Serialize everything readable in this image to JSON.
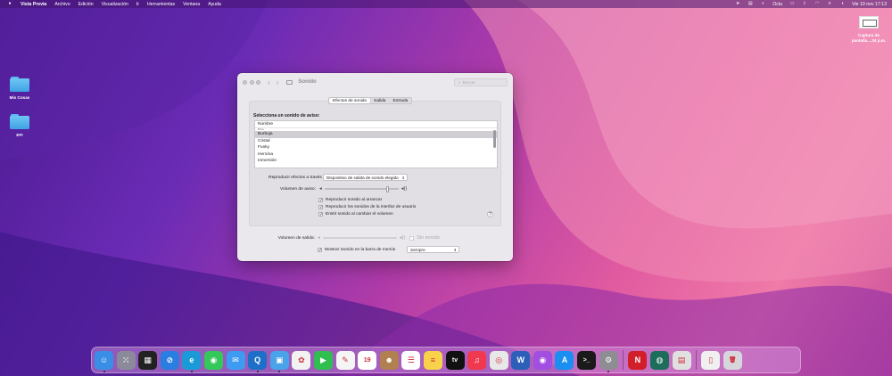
{
  "menubar": {
    "apple": "",
    "app_name": "Vista Previa",
    "menus": [
      "Archivo",
      "Edición",
      "Visualización",
      "Ir",
      "Herramientas",
      "Ventana",
      "Ayuda"
    ],
    "status_text": "Octu",
    "clock": "Vie 19 nov  17:13"
  },
  "desktop": {
    "screenshot_label": "Captura de pantalla....34 p.m.",
    "folder1": "Mis Cosas",
    "folder2": "EFI"
  },
  "window": {
    "title": "Sonido",
    "search_placeholder": "Buscar",
    "tabs": [
      "Efectos de sonido",
      "Salida",
      "Entrada"
    ],
    "heading": "Selecciona un sonido de aviso:",
    "list_header": "Nombre",
    "list_cut_row": "Brisa",
    "list_items": [
      "Burbuja",
      "Cristal",
      "Funky",
      "Heroína",
      "Inmersión"
    ],
    "selected_item": "Burbuja",
    "play_effects_label": "Reproducir efectos a través de:",
    "play_effects_value": "Dispositivo de salida de sonido elegido",
    "alert_volume_label": "Volumen de aviso:",
    "alert_volume_level": 0.85,
    "checks": [
      {
        "label": "Reproducir sonido al arrancar",
        "checked": true
      },
      {
        "label": "Reproducir los sonidos de la interfaz de usuario",
        "checked": true
      },
      {
        "label": "Emitir sonido al cambiar el volumen",
        "checked": true
      }
    ],
    "help": "?",
    "output_volume_label": "Volumen de salida:",
    "mute_label": "Sin sonido",
    "show_menu_label": "Mostrar Sonido en la barra de menús",
    "show_menu_value": "siempre"
  },
  "dock": {
    "apps": [
      {
        "icon": "finder-icon",
        "color": "#3a8ee6",
        "glyph": "☺",
        "running": true
      },
      {
        "icon": "launchpad-icon",
        "color": "#8a8a9a",
        "glyph": "⁙",
        "running": false
      },
      {
        "icon": "mission-control-icon",
        "color": "#222222",
        "glyph": "▦",
        "running": false
      },
      {
        "icon": "safari-icon",
        "color": "#2a7de1",
        "glyph": "⊘",
        "running": false
      },
      {
        "icon": "edge-icon",
        "color": "#1a9bd7",
        "glyph": "e",
        "running": true
      },
      {
        "icon": "messages-icon",
        "color": "#34c759",
        "glyph": "◉",
        "running": false
      },
      {
        "icon": "mail-icon",
        "color": "#3d9bf2",
        "glyph": "✉",
        "running": false
      },
      {
        "icon": "quicktime-icon",
        "color": "#1e6fc8",
        "glyph": "Q",
        "running": true
      },
      {
        "icon": "preview-icon",
        "color": "#4aa2e8",
        "glyph": "▣",
        "running": true
      },
      {
        "icon": "photos-icon",
        "color": "#f2f2f2",
        "glyph": "✿",
        "running": false
      },
      {
        "icon": "facetime-icon",
        "color": "#2fbf4f",
        "glyph": "▶",
        "running": false
      },
      {
        "icon": "freeform-icon",
        "color": "#f5f5f5",
        "glyph": "✎",
        "running": false
      },
      {
        "icon": "calendar-icon",
        "color": "#ffffff",
        "glyph": "19",
        "running": false
      },
      {
        "icon": "contacts-icon",
        "color": "#b08050",
        "glyph": "☻",
        "running": false
      },
      {
        "icon": "reminders-icon",
        "color": "#ffffff",
        "glyph": "☰",
        "running": false
      },
      {
        "icon": "notes-icon",
        "color": "#f7d24a",
        "glyph": "≡",
        "running": false
      },
      {
        "icon": "appletv-icon",
        "color": "#111111",
        "glyph": "tv",
        "running": false
      },
      {
        "icon": "music-icon",
        "color": "#f0394e",
        "glyph": "♫",
        "running": false
      },
      {
        "icon": "screenshot-icon",
        "color": "#e8e8e8",
        "glyph": "◎",
        "running": false
      },
      {
        "icon": "word-icon",
        "color": "#2b5fb8",
        "glyph": "W",
        "running": false
      },
      {
        "icon": "podcasts-icon",
        "color": "#a24ee0",
        "glyph": "◉",
        "running": false
      },
      {
        "icon": "appstore-icon",
        "color": "#1b8ef2",
        "glyph": "A",
        "running": false
      },
      {
        "icon": "terminal-icon",
        "color": "#1a1a1a",
        "glyph": ">_",
        "running": false
      },
      {
        "icon": "system-preferences-icon",
        "color": "#8d8d93",
        "glyph": "⚙",
        "running": true
      },
      {
        "icon": "sep",
        "color": "",
        "glyph": "",
        "running": false
      },
      {
        "icon": "red-app-icon",
        "color": "#d11f2a",
        "glyph": "N",
        "running": false
      },
      {
        "icon": "network-radar-icon",
        "color": "#1c6d5a",
        "glyph": "◍",
        "running": false
      },
      {
        "icon": "disk-utility-icon",
        "color": "#e0e0e0",
        "glyph": "▤",
        "running": false
      },
      {
        "icon": "sep",
        "color": "",
        "glyph": "",
        "running": false
      },
      {
        "icon": "document-stack-icon",
        "color": "#f0f0f0",
        "glyph": "▯",
        "running": false
      },
      {
        "icon": "trash-icon",
        "color": "#d6d6dc",
        "glyph": "🗑",
        "running": false
      }
    ]
  }
}
